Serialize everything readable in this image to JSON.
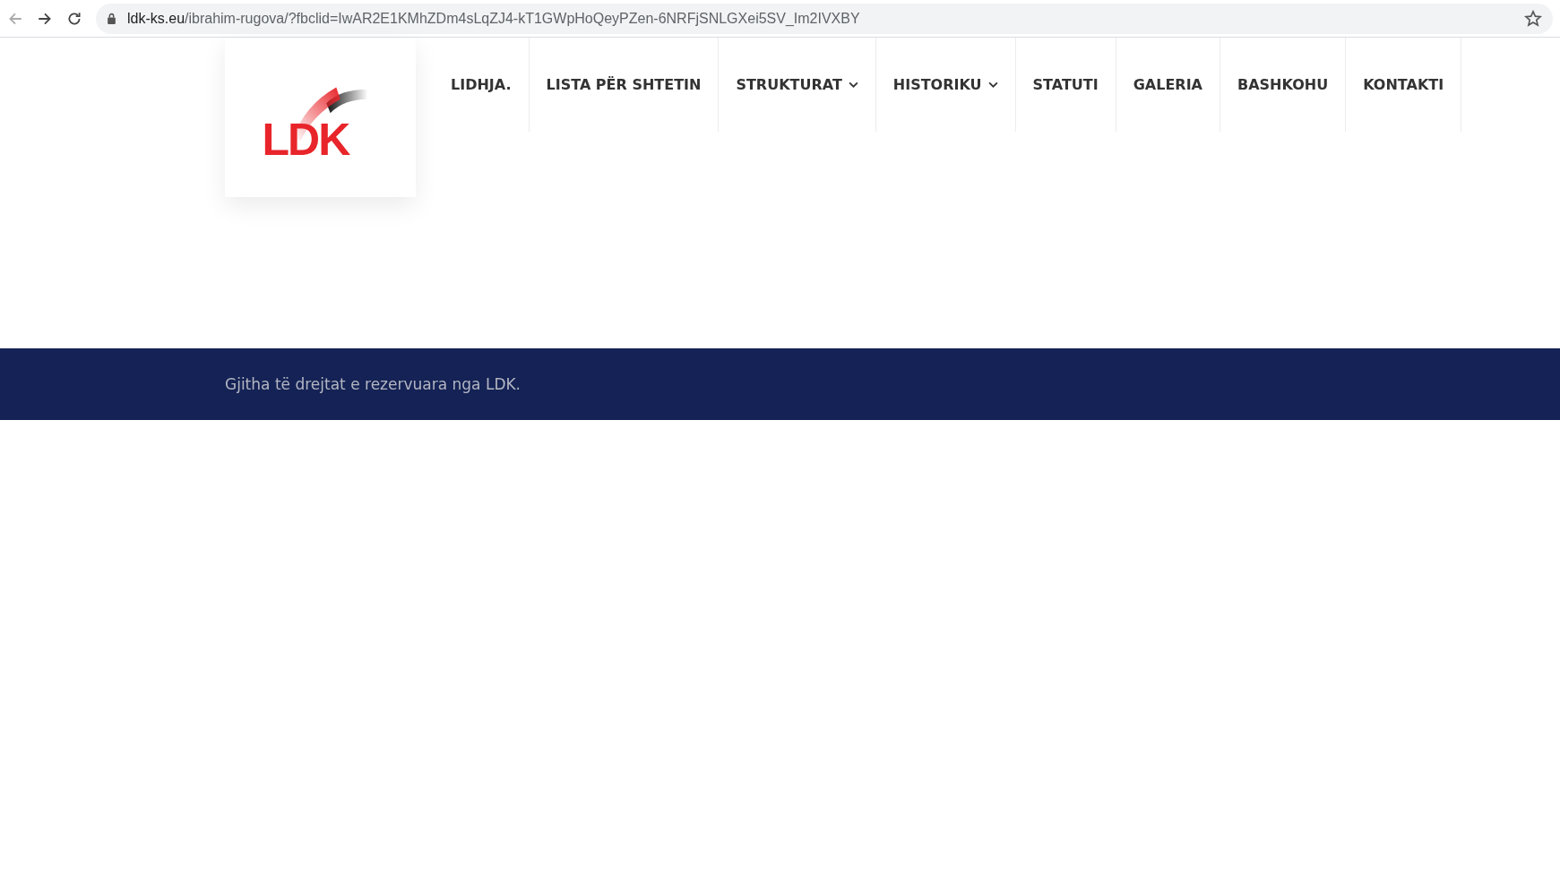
{
  "browser": {
    "url_host": "ldk-ks.eu",
    "url_path": "/ibrahim-rugova/?fbclid=IwAR2E1KMhZDm4sLqZJ4-kT1GWpHoQeyPZen-6NRFjSNLGXei5SV_Im2IVXBY"
  },
  "logo": {
    "text": "LDK"
  },
  "nav": [
    {
      "label": "LIDHJA.",
      "dropdown": false
    },
    {
      "label": "LISTA PËR SHTETIN",
      "dropdown": false
    },
    {
      "label": "STRUKTURAT",
      "dropdown": true
    },
    {
      "label": "HISTORIKU",
      "dropdown": true
    },
    {
      "label": "STATUTI",
      "dropdown": false
    },
    {
      "label": "GALERIA",
      "dropdown": false
    },
    {
      "label": "BASHKOHU",
      "dropdown": false
    },
    {
      "label": "KONTAKTI",
      "dropdown": false
    }
  ],
  "footer": {
    "text": "Gjitha të drejtat e rezervuara nga LDK."
  }
}
